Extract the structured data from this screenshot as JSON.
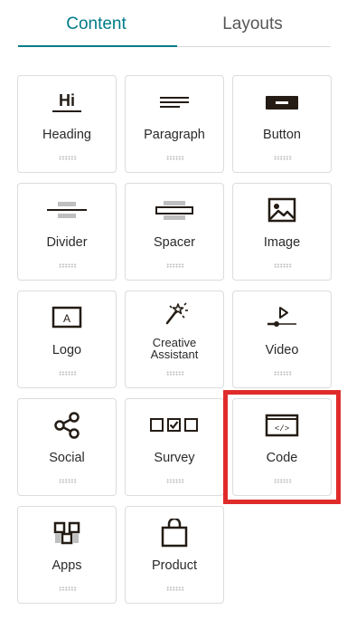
{
  "tabs": {
    "content_label": "Content",
    "layouts_label": "Layouts",
    "active": "Content"
  },
  "blocks": [
    {
      "label": "Heading",
      "icon": "heading-icon"
    },
    {
      "label": "Paragraph",
      "icon": "paragraph-icon"
    },
    {
      "label": "Button",
      "icon": "button-icon"
    },
    {
      "label": "Divider",
      "icon": "divider-icon"
    },
    {
      "label": "Spacer",
      "icon": "spacer-icon"
    },
    {
      "label": "Image",
      "icon": "image-icon"
    },
    {
      "label": "Logo",
      "icon": "logo-icon"
    },
    {
      "label": "Creative Assistant",
      "icon": "creative-assistant-icon"
    },
    {
      "label": "Video",
      "icon": "video-icon"
    },
    {
      "label": "Social",
      "icon": "social-share-icon"
    },
    {
      "label": "Survey",
      "icon": "survey-icon"
    },
    {
      "label": "Code",
      "icon": "code-icon"
    },
    {
      "label": "Apps",
      "icon": "apps-icon"
    },
    {
      "label": "Product",
      "icon": "product-bag-icon"
    }
  ],
  "icon_text": {
    "heading": "Hi",
    "logo": "A",
    "code": "</>"
  },
  "colors": {
    "accent": "#007c89",
    "highlight": "#e02b2b",
    "tile_border": "#dcdcdc"
  }
}
